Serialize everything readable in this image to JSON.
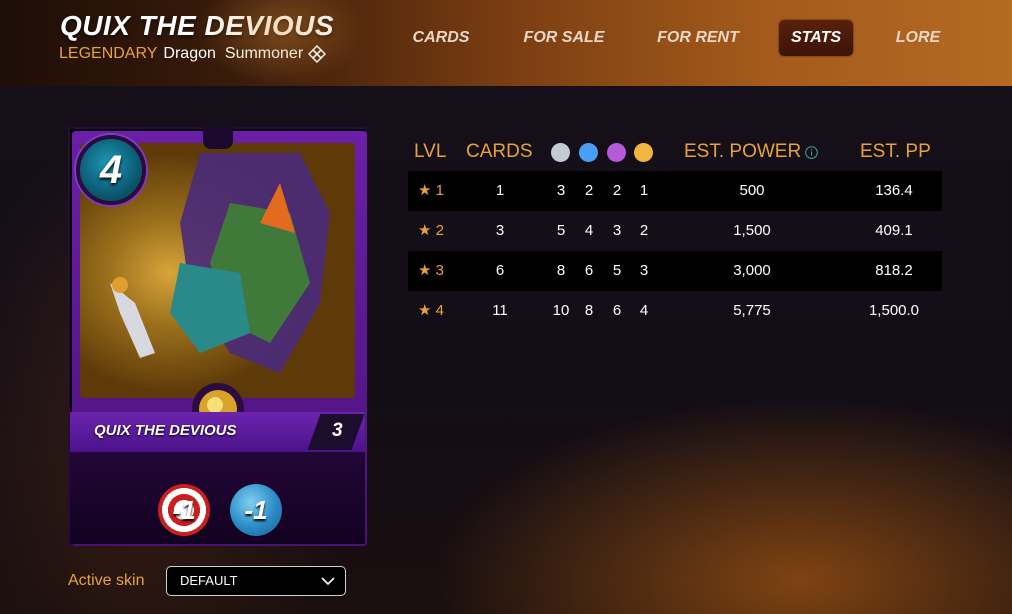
{
  "header": {
    "title": "QUIX THE DEVIOUS",
    "rarity": "LEGENDARY",
    "element": "Dragon",
    "type": "Summoner",
    "edition_icon": "diamond-edition-icon"
  },
  "nav": {
    "items": [
      {
        "label": "CARDS",
        "active": false
      },
      {
        "label": "FOR SALE",
        "active": false
      },
      {
        "label": "FOR RENT",
        "active": false
      },
      {
        "label": "STATS",
        "active": true
      },
      {
        "label": "LORE",
        "active": false
      }
    ]
  },
  "card": {
    "mana": "4",
    "name": "QUIX THE DEVIOUS",
    "level": "3",
    "abilities": [
      {
        "icon": "reduced-ranged-attack-icon",
        "label": "-1"
      },
      {
        "icon": "reduced-magic-attack-icon",
        "label": "-1"
      }
    ],
    "colors": {
      "frame": "#6b1fa8",
      "mana": "#1e99b8"
    }
  },
  "skin": {
    "label": "Active skin",
    "value": "DEFAULT"
  },
  "stats": {
    "headers": {
      "lvl": "LVL",
      "cards": "CARDS",
      "power": "EST. POWER",
      "pp": "EST. PP"
    },
    "rarity_dots": [
      {
        "name": "common",
        "color": "#c4ccd3"
      },
      {
        "name": "rare",
        "color": "#4a9ff2"
      },
      {
        "name": "epic",
        "color": "#b45bd9"
      },
      {
        "name": "legendary",
        "color": "#f2b640"
      }
    ],
    "rows": [
      {
        "lvl": "1",
        "cards": "1",
        "c": "3",
        "r": "2",
        "e": "2",
        "l": "1",
        "power": "500",
        "pp": "136.4"
      },
      {
        "lvl": "2",
        "cards": "3",
        "c": "5",
        "r": "4",
        "e": "3",
        "l": "2",
        "power": "1,500",
        "pp": "409.1"
      },
      {
        "lvl": "3",
        "cards": "6",
        "c": "8",
        "r": "6",
        "e": "5",
        "l": "3",
        "power": "3,000",
        "pp": "818.2"
      },
      {
        "lvl": "4",
        "cards": "11",
        "c": "10",
        "r": "8",
        "e": "6",
        "l": "4",
        "power": "5,775",
        "pp": "1,500.0"
      }
    ],
    "star": "★"
  }
}
